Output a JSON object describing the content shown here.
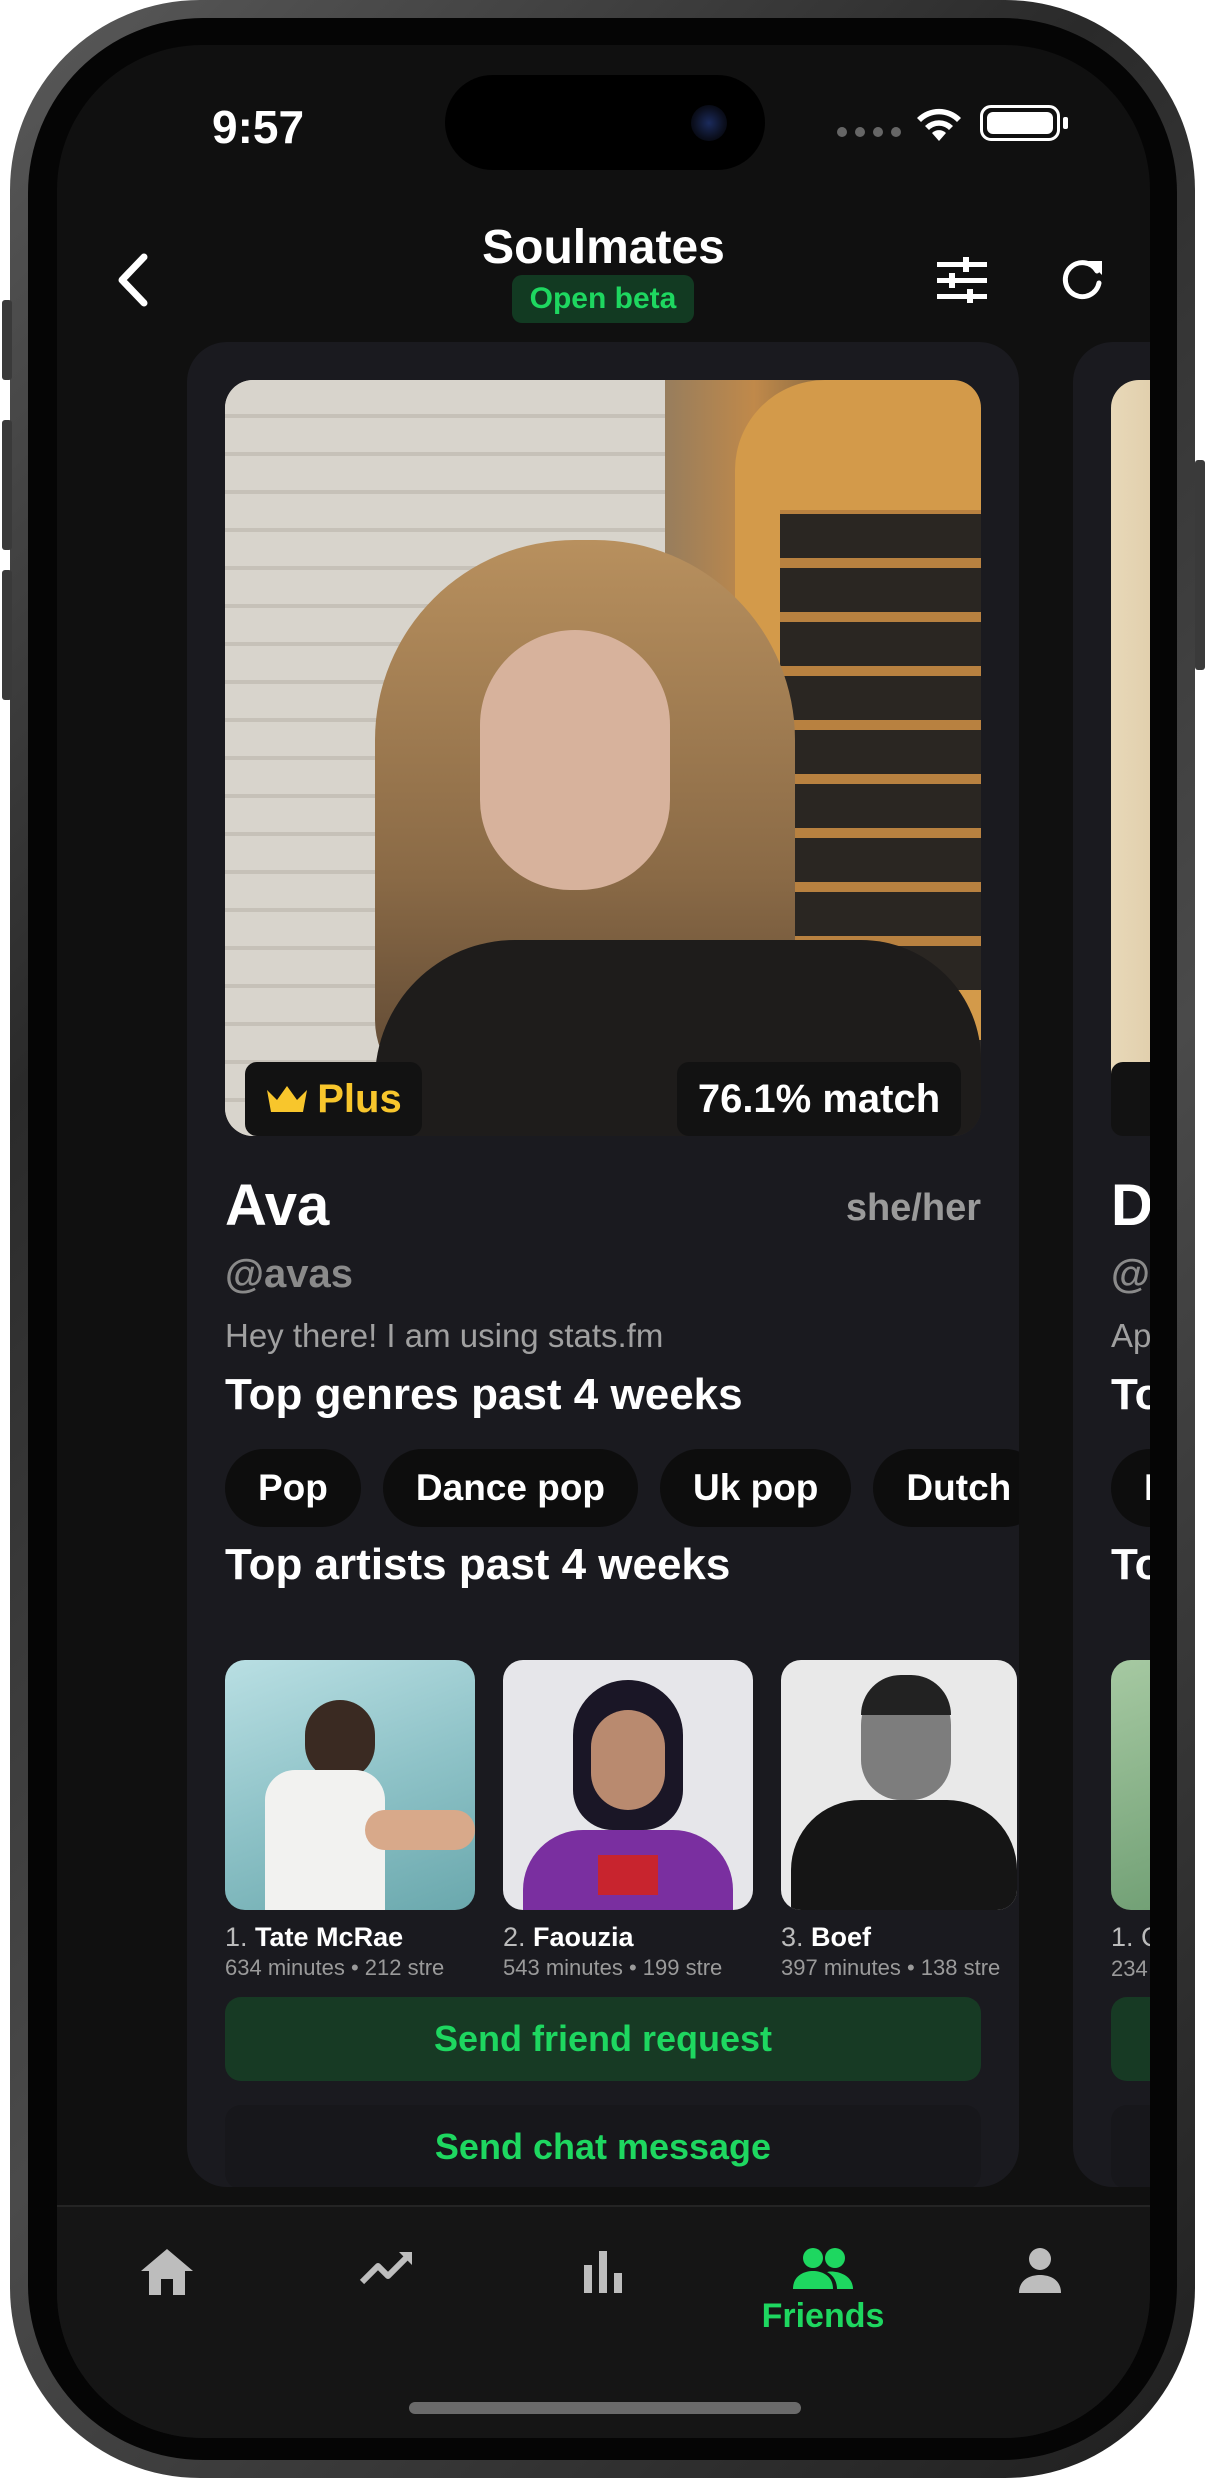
{
  "status_bar": {
    "time": "9:57"
  },
  "header": {
    "title": "Soulmates",
    "badge": "Open beta"
  },
  "profile": {
    "membership": "Plus",
    "match": "76.1% match",
    "name": "Ava",
    "pronouns": "she/her",
    "username": "@avas",
    "bio": "Hey there! I am using stats.fm",
    "genres_title": "Top genres past 4 weeks",
    "genres": [
      "Pop",
      "Dance pop",
      "Uk pop",
      "Dutch"
    ],
    "artists_title": "Top artists past 4 weeks",
    "artists": [
      {
        "rank": "1.",
        "name": "Tate McRae",
        "stats": "634 minutes • 212 stre"
      },
      {
        "rank": "2.",
        "name": "Faouzia",
        "stats": "543 minutes • 199 stre"
      },
      {
        "rank": "3.",
        "name": "Boef",
        "stats": "397 minutes • 138 stre"
      }
    ],
    "friend_button": "Send friend request",
    "chat_button": "Send chat message"
  },
  "next_profile_peek": {
    "name_initial": "D",
    "username_partial": "@",
    "bio_partial": "Ap",
    "genres_partial": "To",
    "chip_partial": "F",
    "artists_partial": "To",
    "artist_rank": "1. C",
    "artist_stats": "234"
  },
  "bottom_nav": {
    "active_label": "Friends",
    "items": [
      "home-icon",
      "trending-icon",
      "stats-icon",
      "friends-icon",
      "profile-icon"
    ]
  },
  "colors": {
    "accent": "#1ed760",
    "background": "#101010",
    "card": "#1a1a1f",
    "plus_gold": "#f8c62c"
  }
}
